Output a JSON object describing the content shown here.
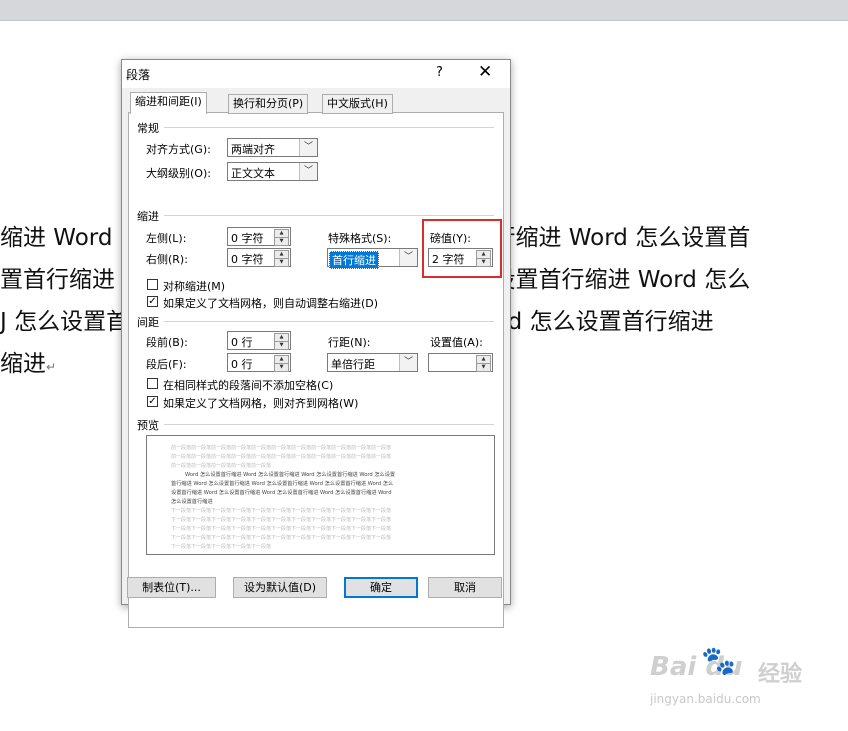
{
  "document": {
    "lines": [
      "缩进 Word 怎么设置首行缩进 Word 怎么设置首行缩进 Word 怎么设置首",
      "置首行缩进 Word 怎么设置首行缩进 Word 怎么设置首行缩进 Word 怎么",
      "J 怎么设置首行缩进 Word 怎么设置首行缩进  Word  怎么设置首行缩进",
      "缩进"
    ],
    "paragraph_mark": "↵"
  },
  "dialog": {
    "title": "段落",
    "help": "?",
    "close": "✕",
    "tabs": [
      "缩进和间距(I)",
      "换行和分页(P)",
      "中文版式(H)"
    ],
    "general": {
      "heading": "常规",
      "alignment_label": "对齐方式(G):",
      "alignment_value": "两端对齐",
      "outline_label": "大纲级别(O):",
      "outline_value": "正文文本"
    },
    "indent": {
      "heading": "缩进",
      "left_label": "左侧(L):",
      "left_value": "0 字符",
      "right_label": "右侧(R):",
      "right_value": "0 字符",
      "special_label": "特殊格式(S):",
      "special_value": "首行缩进",
      "by_label": "磅值(Y):",
      "by_value": "2 字符",
      "mirror_label": "对称缩进(M)",
      "auto_adjust_label": "如果定义了文档网格，则自动调整右缩进(D)"
    },
    "spacing": {
      "heading": "间距",
      "before_label": "段前(B):",
      "before_value": "0 行",
      "after_label": "段后(F):",
      "after_value": "0 行",
      "line_label": "行距(N):",
      "line_value": "单倍行距",
      "at_label": "设置值(A):",
      "at_value": "",
      "no_space_label": "在相同样式的段落间不添加空格(C)",
      "snap_grid_label": "如果定义了文档网格，则对齐到网格(W)"
    },
    "preview": {
      "heading": "预览",
      "grey_top": [
        "前一段落前一段落前一段落前一段落前一段落前一段落前一段落前一段落前一段落前一段落前一段落",
        "前一段落前一段落前一段落前一段落前一段落前一段落前一段落前一段落前一段落前一段落前一段落",
        "前一段落前一段落前一段落前一段落前一段落"
      ],
      "sample": [
        "Word 怎么设置首行缩进 Word 怎么设置首行缩进 Word 怎么设置首行缩进 Word 怎么设置",
        "首行缩进 Word 怎么设置首行缩进 Word 怎么设置首行缩进 Word 怎么设置首行缩进 Word 怎么",
        "设置首行缩进 Word 怎么设置首行缩进 Word 怎么设置首行缩进 Word 怎么设置首行缩进 Word",
        "怎么设置首行缩进"
      ],
      "grey_bottom": [
        "下一段落下一段落下一段落下一段落下一段落下一段落下一段落下一段落下一段落下一段落下一段落",
        "下一段落下一段落下一段落下一段落下一段落下一段落下一段落下一段落下一段落下一段落下一段落",
        "下一段落下一段落下一段落下一段落下一段落下一段落下一段落下一段落下一段落下一段落下一段落",
        "下一段落下一段落下一段落下一段落下一段落下一段落下一段落下一段落下一段落下一段落下一段落",
        "下一段落下一段落下一段落下一段落下一段落"
      ]
    },
    "buttons": {
      "tabs": "制表位(T)...",
      "set_default": "设为默认值(D)",
      "ok": "确定",
      "cancel": "取消"
    },
    "mirror_checked": false,
    "auto_adjust_checked": true,
    "no_space_checked": false,
    "snap_grid_checked": true
  },
  "watermark": {
    "logo": "Bai  du",
    "site": "经验",
    "url": "jingyan.baidu.com"
  },
  "colors": {
    "highlight": "#d82d2d",
    "selection": "#0078d7"
  }
}
